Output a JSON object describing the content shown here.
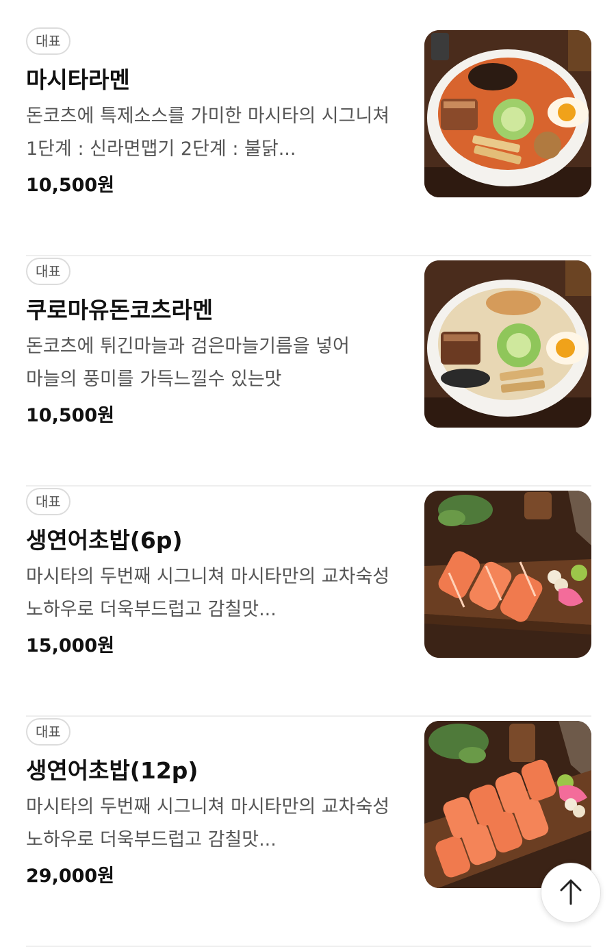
{
  "menu": {
    "items": [
      {
        "badge": "대표",
        "name": "마시타라멘",
        "description": "돈코츠에 특제소스를 가미한 마시타의 시그니쳐 1단계 : 신라면맵기 2단계 : 불닭...",
        "price": "10,500원",
        "image": "spicy-ramen-photo"
      },
      {
        "badge": "대표",
        "name": "쿠로마유돈코츠라멘",
        "description": "돈코츠에 튀긴마늘과 검은마늘기름을 넣어 마늘의 풍미를 가득느낄수 있는맛",
        "price": "10,500원",
        "image": "black-garlic-tonkotsu-ramen-photo"
      },
      {
        "badge": "대표",
        "name": "생연어초밥(6p)",
        "description": "마시타의 두번째 시그니쳐 마시타만의 교차숙성 노하우로 더욱부드럽고 감칠맛...",
        "price": "15,000원",
        "image": "salmon-sushi-6p-photo"
      },
      {
        "badge": "대표",
        "name": "생연어초밥(12p)",
        "description": "마시타의 두번째 시그니쳐 마시타만의 교차숙성 노하우로 더욱부드럽고 감칠맛...",
        "price": "29,000원",
        "image": "salmon-sushi-12p-photo"
      }
    ]
  },
  "scroll_top_button": {
    "icon": "arrow-up-icon"
  }
}
